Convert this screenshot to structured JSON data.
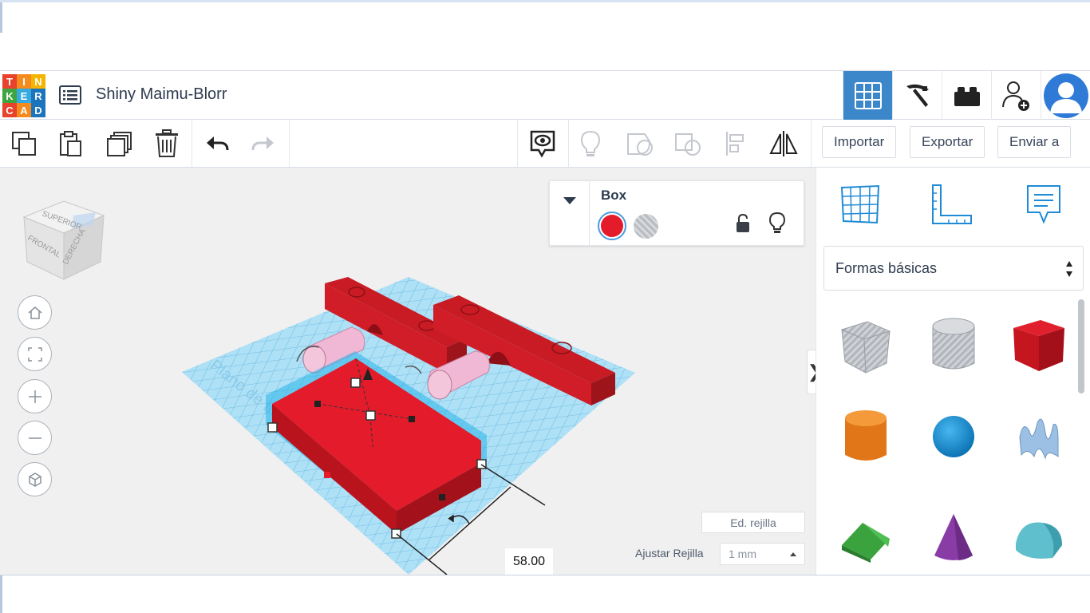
{
  "app": {
    "logo_letters": [
      "T",
      "I",
      "N",
      "K",
      "E",
      "R",
      "C",
      "A",
      "D"
    ],
    "logo_colors": [
      "#e8412c",
      "#f58a1f",
      "#f5b400",
      "#3ea541",
      "#35a9e0",
      "#1c75bc",
      "#e8412c",
      "#f58a1f",
      "#1c75bc"
    ],
    "project_title": "Shiny Maimu-Blorr"
  },
  "header": {
    "buttons": [
      {
        "name": "3d-design-view",
        "icon": "grid-icon",
        "active": true
      },
      {
        "name": "blocks-view",
        "icon": "pickaxe-icon",
        "active": false
      },
      {
        "name": "bricks-view",
        "icon": "brick-icon",
        "active": false
      },
      {
        "name": "invite-user",
        "icon": "add-user-icon",
        "active": false
      }
    ],
    "accent": "#3c87c9"
  },
  "toolbar": {
    "import_label": "Importar",
    "export_label": "Exportar",
    "send_label": "Enviar a"
  },
  "viewcube": {
    "top": "SUPERIOR",
    "front": "FRONTAL",
    "right": "DERECHA"
  },
  "inspector": {
    "shape_name": "Box",
    "solid_color": "#e41b2b"
  },
  "workplane": {
    "watermark": "Plano de trabajo",
    "dimension_value": "58.00",
    "edit_grid_label": "Ed. rejilla",
    "snap_label": "Ajustar Rejilla",
    "snap_value": "1 mm"
  },
  "shapes_panel": {
    "category": "Formas básicas",
    "shapes": [
      {
        "name": "box-hole",
        "color": "#b8bcc2"
      },
      {
        "name": "cylinder-hole",
        "color": "#c7cace"
      },
      {
        "name": "box",
        "color": "#d4171f"
      },
      {
        "name": "cylinder",
        "color": "#e97c1b"
      },
      {
        "name": "sphere",
        "color": "#1b8fd1"
      },
      {
        "name": "scribble",
        "color": "#8fb4d9"
      },
      {
        "name": "roof",
        "color": "#3aa33e"
      },
      {
        "name": "cone",
        "color": "#8a3ca6"
      },
      {
        "name": "round-roof",
        "color": "#58b9c8"
      }
    ]
  }
}
